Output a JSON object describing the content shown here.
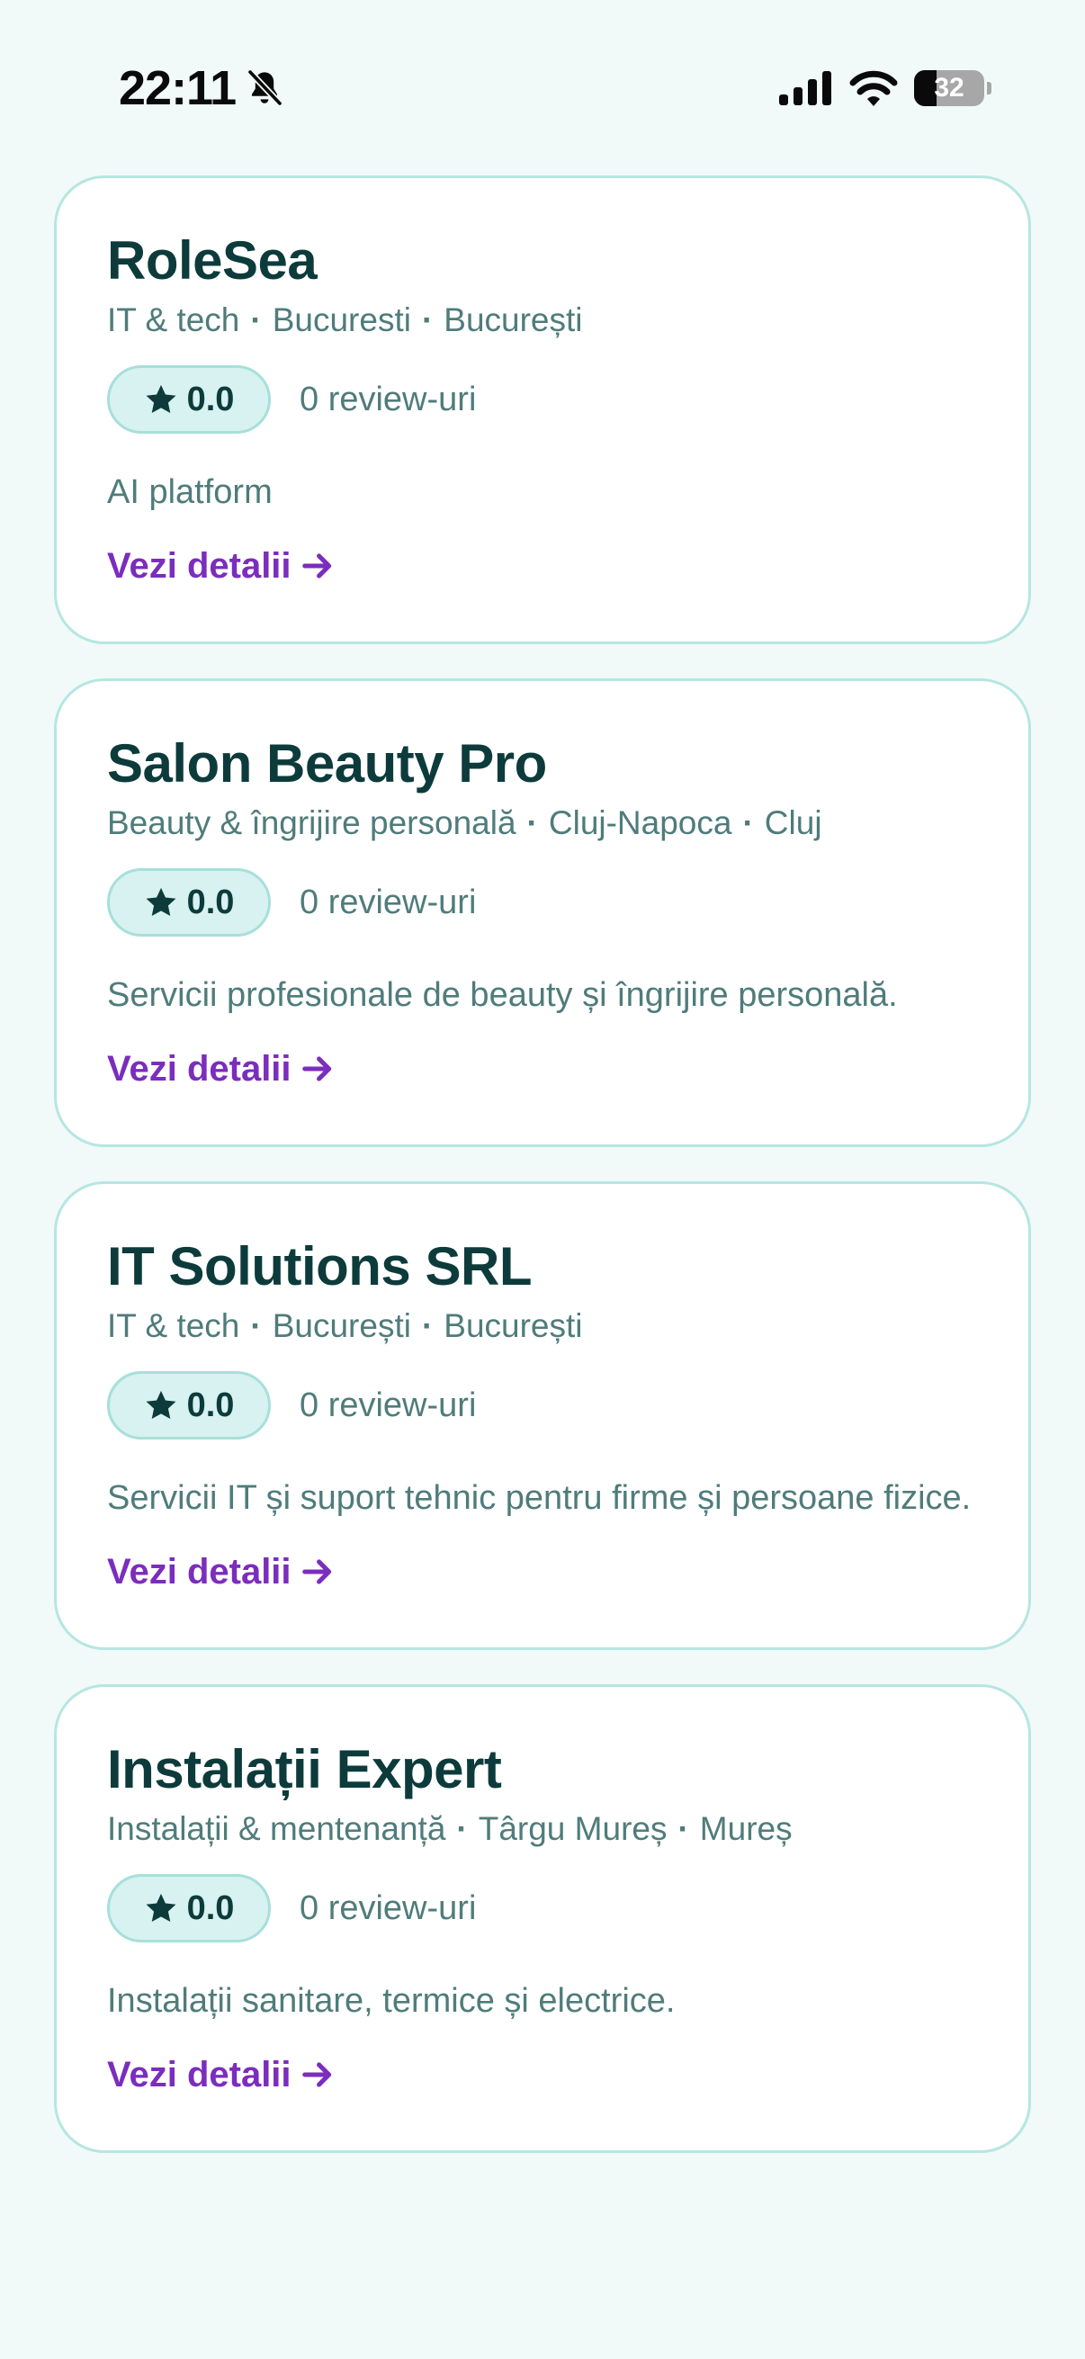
{
  "status_bar": {
    "time": "22:11",
    "battery_level": 32,
    "battery_text": "32",
    "icons": [
      "bell-slash-icon",
      "cellular-signal-icon",
      "wifi-icon",
      "battery-icon"
    ]
  },
  "colors": {
    "background": "#f1faf8",
    "card_border": "#b6e6e2",
    "title": "#0d3b3b",
    "muted_text": "#4f7c7b",
    "badge_bg": "#d7f2f0",
    "link": "#7b2dbd"
  },
  "cards": [
    {
      "name": "RoleSea",
      "category": "IT & tech",
      "city": "Bucuresti",
      "county": "București",
      "rating": "0.0",
      "reviews": "0 review-uri",
      "description": "AI platform",
      "link_label": "Vezi detalii"
    },
    {
      "name": "Salon Beauty Pro",
      "category": "Beauty & îngrijire personală",
      "city": "Cluj-Napoca",
      "county": "Cluj",
      "rating": "0.0",
      "reviews": "0 review-uri",
      "description": "Servicii profesionale de beauty și îngrijire personală.",
      "link_label": "Vezi detalii"
    },
    {
      "name": "IT Solutions SRL",
      "category": "IT & tech",
      "city": "București",
      "county": "București",
      "rating": "0.0",
      "reviews": "0 review-uri",
      "description": "Servicii IT și suport tehnic pentru firme și persoane fizice.",
      "link_label": "Vezi detalii"
    },
    {
      "name": "Instalații Expert",
      "category": "Instalații & mentenanță",
      "city": "Târgu Mureș",
      "county": "Mureș",
      "rating": "0.0",
      "reviews": "0 review-uri",
      "description": "Instalații sanitare, termice și electrice.",
      "link_label": "Vezi detalii"
    }
  ]
}
